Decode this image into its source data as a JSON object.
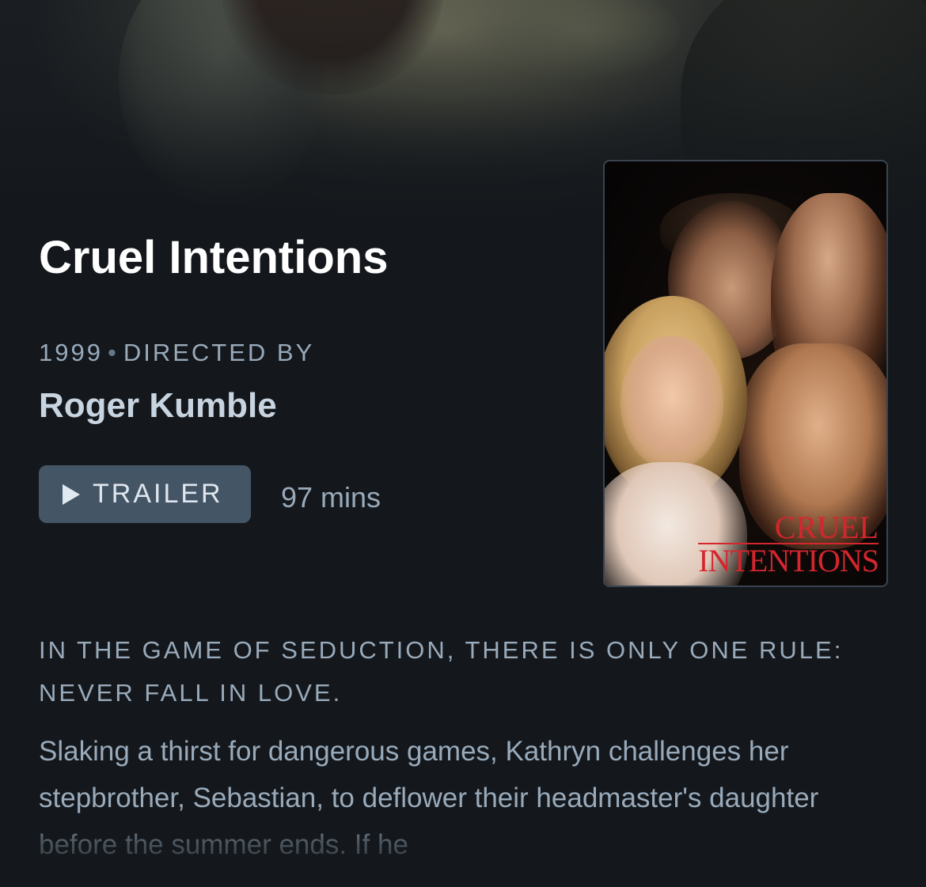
{
  "film": {
    "title": "Cruel Intentions",
    "year": "1999",
    "directed_by_label": "DIRECTED BY",
    "director": "Roger Kumble",
    "runtime": "97 mins",
    "trailer_label": "TRAILER",
    "tagline": "IN THE GAME OF SEDUCTION, THERE IS ONLY ONE RULE: NEVER FALL IN LOVE.",
    "synopsis": "Slaking a thirst for dangerous games, Kathryn challenges her stepbrother, Sebastian, to deflower their headmaster's daughter before the summer ends. If he",
    "poster": {
      "title_line1": "CRUEL",
      "title_line2": "INTENTIONS"
    }
  },
  "colors": {
    "background": "#14181c",
    "button": "#445566",
    "muted_text": "#99aabb",
    "poster_title": "#d4262e"
  },
  "icons": {
    "trailer": "play-icon"
  }
}
